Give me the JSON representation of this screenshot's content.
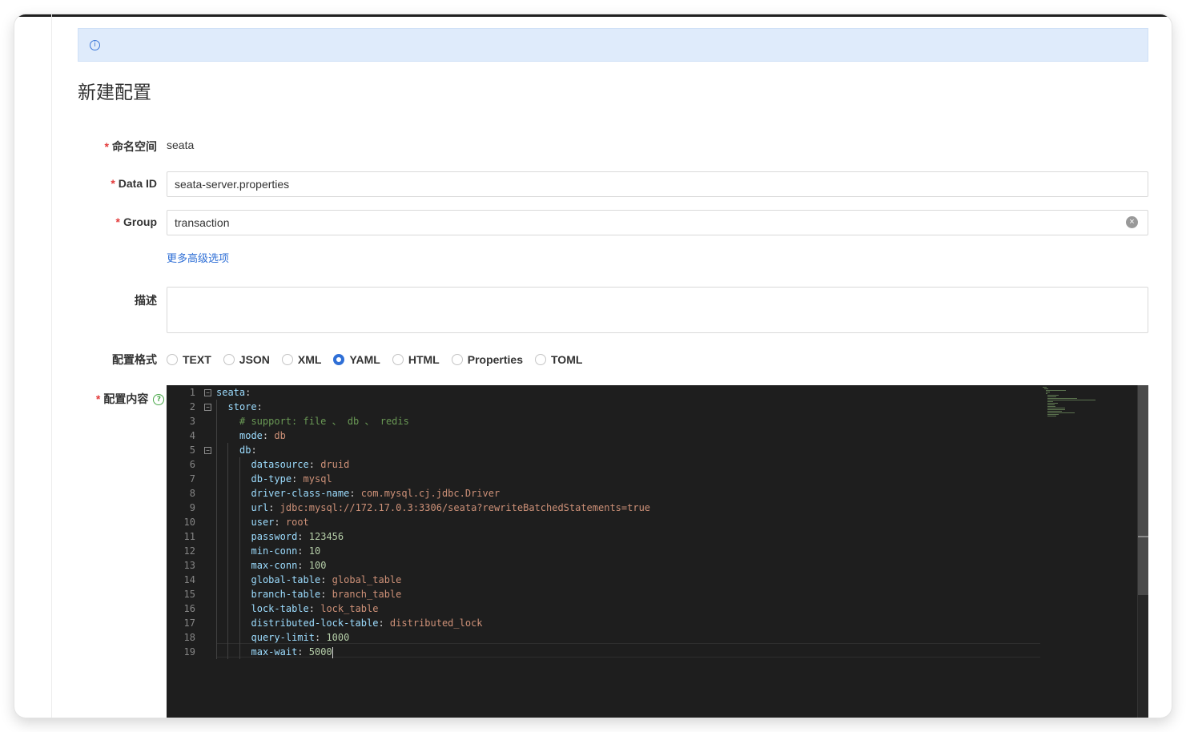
{
  "page": {
    "title": "新建配置"
  },
  "form": {
    "namespace": {
      "label": "命名空间",
      "value": "seata"
    },
    "data_id": {
      "label": "Data ID",
      "value": "seata-server.properties"
    },
    "group": {
      "label": "Group",
      "value": "transaction"
    },
    "more_options": "更多高级选项",
    "description": {
      "label": "描述",
      "value": ""
    },
    "format": {
      "label": "配置格式",
      "options": [
        "TEXT",
        "JSON",
        "XML",
        "YAML",
        "HTML",
        "Properties",
        "TOML"
      ],
      "selected": "YAML"
    },
    "content": {
      "label": "配置内容",
      "colon": ":"
    }
  },
  "editor": {
    "line_numbers": [
      "1",
      "2",
      "3",
      "4",
      "5",
      "6",
      "7",
      "8",
      "9",
      "10",
      "11",
      "12",
      "13",
      "14",
      "15",
      "16",
      "17",
      "18",
      "19"
    ],
    "lines": [
      {
        "key": "seata",
        "sep": ":",
        "val": ""
      },
      {
        "key": "store",
        "sep": ":",
        "val": ""
      },
      {
        "comment": "# support: file 、 db 、 redis"
      },
      {
        "key": "mode",
        "sep": ":",
        "val": "db"
      },
      {
        "key": "db",
        "sep": ":",
        "val": ""
      },
      {
        "key": "datasource",
        "sep": ":",
        "val": "druid"
      },
      {
        "key": "db-type",
        "sep": ":",
        "val": "mysql"
      },
      {
        "key": "driver-class-name",
        "sep": ":",
        "val": "com.mysql.cj.jdbc.Driver"
      },
      {
        "key": "url",
        "sep": ":",
        "val": "jdbc:mysql://172.17.0.3:3306/seata?rewriteBatchedStatements=true"
      },
      {
        "key": "user",
        "sep": ":",
        "val": "root"
      },
      {
        "key": "password",
        "sep": ":",
        "val": "123456"
      },
      {
        "key": "min-conn",
        "sep": ":",
        "val": "10"
      },
      {
        "key": "max-conn",
        "sep": ":",
        "val": "100"
      },
      {
        "key": "global-table",
        "sep": ":",
        "val": "global_table"
      },
      {
        "key": "branch-table",
        "sep": ":",
        "val": "branch_table"
      },
      {
        "key": "lock-table",
        "sep": ":",
        "val": "lock_table"
      },
      {
        "key": "distributed-lock-table",
        "sep": ":",
        "val": "distributed_lock"
      },
      {
        "key": "query-limit",
        "sep": ":",
        "val": "1000"
      },
      {
        "key": "max-wait",
        "sep": ":",
        "val": "5000"
      }
    ]
  },
  "icons": {
    "info": "info-icon",
    "clear": "clear-icon",
    "help": "help-icon",
    "fold": "fold-icon"
  },
  "colors": {
    "accent": "#2f6fd6",
    "required": "#e33a3a",
    "notice_bg": "#dfebfb",
    "editor_bg": "#1e1e1e"
  }
}
